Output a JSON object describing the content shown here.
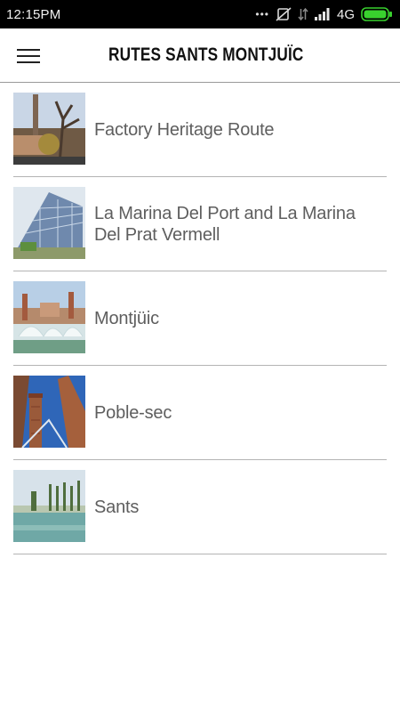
{
  "status_bar": {
    "time": "12:15PM",
    "network": "4G",
    "icons": [
      "more-dots-icon",
      "no-sim-icon",
      "data-arrows-icon",
      "signal-icon",
      "battery-icon"
    ]
  },
  "header": {
    "title": "RUTES SANTS MONTJUÏC",
    "menu_icon": "hamburger-menu-icon"
  },
  "routes": [
    {
      "label": "Factory Heritage Route"
    },
    {
      "label": "La Marina Del Port and La Marina Del Prat Vermell"
    },
    {
      "label": "Montjüic"
    },
    {
      "label": "Poble-sec"
    },
    {
      "label": "Sants"
    }
  ],
  "colors": {
    "status_bar_bg": "#000000",
    "battery_green": "#39d12e",
    "item_text": "#5e5e5e",
    "divider": "#b4b4b4"
  }
}
